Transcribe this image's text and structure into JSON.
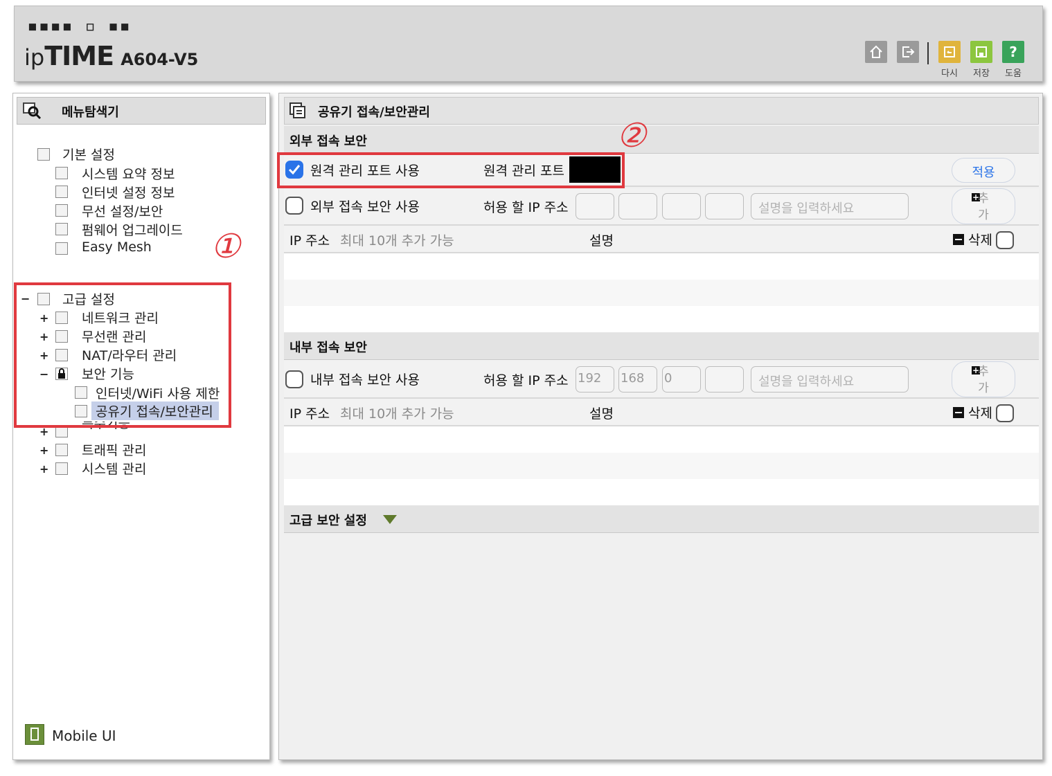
{
  "header": {
    "brand_top": "▪▪▪▪ ▫ ▪▪",
    "brand_ip": "ip",
    "brand_time": "TIME",
    "brand_model": "A604-V5",
    "buttons": [
      {
        "icon": "home-icon",
        "label": ""
      },
      {
        "icon": "logout-icon",
        "label": ""
      },
      {
        "icon": "restore-icon",
        "label": "다시"
      },
      {
        "icon": "save-icon",
        "label": "저장"
      },
      {
        "icon": "help-icon",
        "label": "도움"
      }
    ],
    "colors": {
      "restore": "#e0b43c",
      "save": "#8cc63f",
      "help": "#39a35a",
      "home": "#9a9a9a",
      "logout": "#9a9a9a"
    }
  },
  "sidebar": {
    "title": "메뉴탐색기",
    "basic": {
      "label": "기본 설정",
      "items": [
        "시스템 요약 정보",
        "인터넷 설정 정보",
        "무선 설정/보안",
        "펌웨어 업그레이드",
        "Easy Mesh"
      ]
    },
    "advanced": {
      "label": "고급 설정",
      "toggle": "−",
      "items": [
        {
          "label": "네트워크 관리",
          "toggle": "+"
        },
        {
          "label": "무선랜 관리",
          "toggle": "+"
        },
        {
          "label": "NAT/라우터 관리",
          "toggle": "+"
        },
        {
          "label": "보안 기능",
          "toggle": "−"
        }
      ],
      "security_children": [
        "인터넷/WiFi 사용 제한",
        "공유기 접속/보안관리"
      ],
      "more_items": [
        {
          "label": "특수기능",
          "toggle": "+"
        },
        {
          "label": "트래픽 관리",
          "toggle": "+"
        },
        {
          "label": "시스템 관리",
          "toggle": "+"
        }
      ]
    },
    "mobile_ui": "Mobile UI",
    "annotation_1": "①"
  },
  "main": {
    "title": "공유기 접속/보안관리",
    "external": {
      "title": "외부 접속 보안",
      "remote_checkbox_label": "원격 관리 포트 사용",
      "remote_checked": true,
      "remote_port_label": "원격 관리 포트",
      "apply_button": "적용",
      "ext_checkbox_label": "외부 접속 보안 사용",
      "ext_checked": false,
      "allow_ip_label": "허용 할 IP 주소",
      "ip": [
        "",
        "",
        "",
        ""
      ],
      "desc_placeholder": "설명을 입력하세요",
      "add_button": "추가",
      "list_ip_header": "IP 주소",
      "list_max": "최대 10개 추가 가능",
      "list_desc_header": "설명",
      "delete_label": "삭제"
    },
    "internal": {
      "title": "내부 접속 보안",
      "checkbox_label": "내부 접속 보안 사용",
      "checked": false,
      "allow_ip_label": "허용 할 IP 주소",
      "ip": [
        "192",
        "168",
        "0",
        ""
      ],
      "desc_placeholder": "설명을 입력하세요",
      "add_button": "추가",
      "list_ip_header": "IP 주소",
      "list_max": "최대 10개 추가 가능",
      "list_desc_header": "설명",
      "delete_label": "삭제"
    },
    "advanced_title": "고급 보안 설정",
    "annotation_2": "②"
  }
}
